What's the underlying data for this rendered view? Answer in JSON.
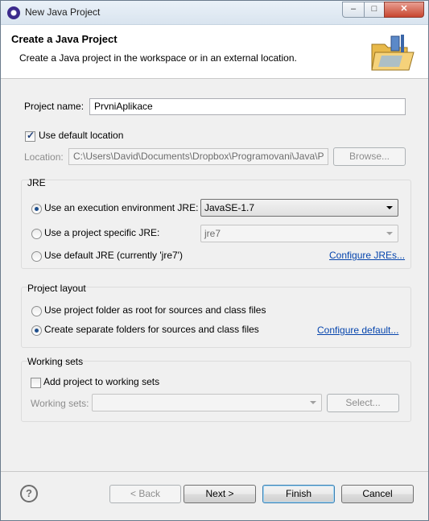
{
  "window": {
    "title": "New Java Project",
    "icon": "eclipse-icon",
    "controls": {
      "minimize": "–",
      "maximize": "□",
      "close": "✕"
    }
  },
  "header": {
    "title": "Create a Java Project",
    "subtitle": "Create a Java project in the workspace or in an external location.",
    "graphic": "new-java-project-wizard-icon"
  },
  "project": {
    "name_label": "Project name:",
    "name_value": "PrvniAplikace",
    "use_default_location_label": "Use default location",
    "use_default_location_checked": true,
    "location_label": "Location:",
    "location_value": "C:\\Users\\David\\Documents\\Dropbox\\Programovani\\Java\\P",
    "browse_label": "Browse..."
  },
  "jre": {
    "group_title": "JRE",
    "option_execution_env": "Use an execution environment JRE:",
    "execution_env_value": "JavaSE-1.7",
    "option_project_specific": "Use a project specific JRE:",
    "project_specific_value": "jre7",
    "option_default": "Use default JRE (currently 'jre7')",
    "configure_link": "Configure JREs...",
    "selected": "execution_env"
  },
  "layout": {
    "group_title": "Project layout",
    "option_root": "Use project folder as root for sources and class files",
    "option_separate": "Create separate folders for sources and class files",
    "configure_link": "Configure default...",
    "selected": "separate"
  },
  "working_sets": {
    "group_title": "Working sets",
    "add_label": "Add project to working sets",
    "add_checked": false,
    "sets_label": "Working sets:",
    "sets_value": "",
    "select_label": "Select..."
  },
  "footer": {
    "help_icon": "?",
    "back_label": "< Back",
    "next_label": "Next >",
    "finish_label": "Finish",
    "cancel_label": "Cancel"
  }
}
